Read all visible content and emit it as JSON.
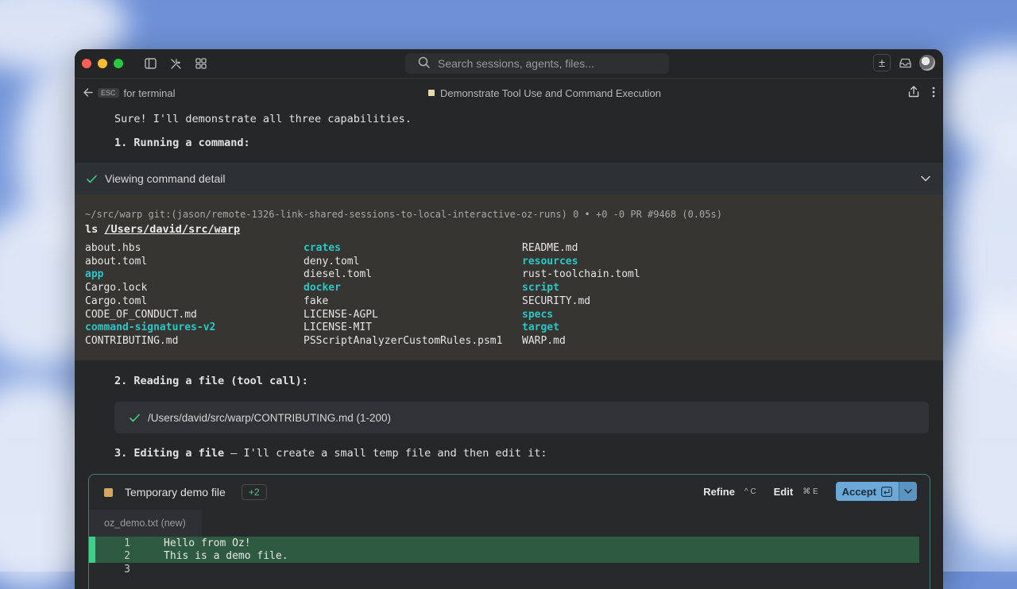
{
  "toolbar": {
    "search_placeholder": "Search sessions, agents, files...",
    "new_tab": "±"
  },
  "subbar": {
    "esc_key": "ESC",
    "esc_text": "for terminal",
    "conversation_title": "Demonstrate Tool Use and Command Execution"
  },
  "messages": {
    "intro": "Sure! I'll demonstrate all three capabilities.",
    "step1": "1. Running a command:",
    "step2": "2. Reading a file (tool call):",
    "step3_bold": "3. Editing a file",
    "step3_rest": " — I'll create a small temp file and then edit it:"
  },
  "command": {
    "header": "Viewing command detail",
    "prompt": "~/src/warp git:(jason/remote-1326-link-shared-sessions-to-local-interactive-oz-runs) 0 • +0 -0 PR #9468 (0.05s)",
    "cmd": "ls",
    "arg": "/Users/david/src/warp",
    "columns": [
      [
        {
          "name": "about.hbs",
          "dir": false
        },
        {
          "name": "about.toml",
          "dir": false
        },
        {
          "name": "app",
          "dir": true
        },
        {
          "name": "Cargo.lock",
          "dir": false
        },
        {
          "name": "Cargo.toml",
          "dir": false
        },
        {
          "name": "CODE_OF_CONDUCT.md",
          "dir": false
        },
        {
          "name": "command-signatures-v2",
          "dir": true
        },
        {
          "name": "CONTRIBUTING.md",
          "dir": false
        }
      ],
      [
        {
          "name": "crates",
          "dir": true
        },
        {
          "name": "deny.toml",
          "dir": false
        },
        {
          "name": "diesel.toml",
          "dir": false
        },
        {
          "name": "docker",
          "dir": true
        },
        {
          "name": "fake",
          "dir": false
        },
        {
          "name": "LICENSE-AGPL",
          "dir": false
        },
        {
          "name": "LICENSE-MIT",
          "dir": false
        },
        {
          "name": "PSScriptAnalyzerCustomRules.psm1",
          "dir": false
        }
      ],
      [
        {
          "name": "README.md",
          "dir": false
        },
        {
          "name": "resources",
          "dir": true
        },
        {
          "name": "rust-toolchain.toml",
          "dir": false
        },
        {
          "name": "script",
          "dir": true
        },
        {
          "name": "SECURITY.md",
          "dir": false
        },
        {
          "name": "specs",
          "dir": true
        },
        {
          "name": "target",
          "dir": true
        },
        {
          "name": "WARP.md",
          "dir": false
        }
      ]
    ]
  },
  "tool_call": {
    "text": "/Users/david/src/warp/CONTRIBUTING.md (1-200)"
  },
  "edit": {
    "title": "Temporary demo file",
    "badge": "+2",
    "refine_label": "Refine",
    "refine_shortcut": "^ C",
    "edit_label": "Edit",
    "edit_shortcut": "⌘ E",
    "accept_label": "Accept",
    "file_tab": "oz_demo.txt (new)",
    "lines": [
      {
        "num": "1",
        "text": "Hello from Oz!",
        "added": true
      },
      {
        "num": "2",
        "text": "This is a demo file.",
        "added": true
      },
      {
        "num": "3",
        "text": "",
        "added": false
      }
    ]
  }
}
